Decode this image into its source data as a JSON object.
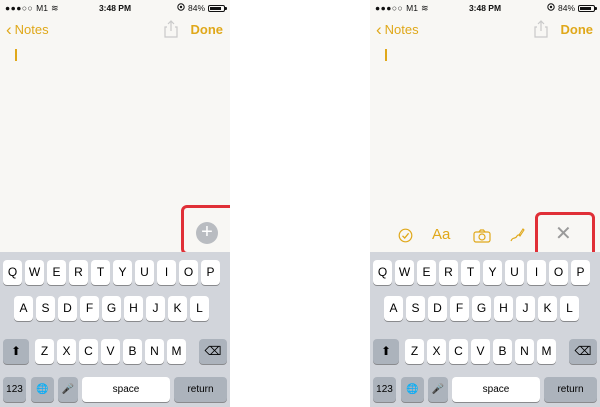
{
  "status_bar": {
    "signal": "●●●○○",
    "carrier": "M1",
    "wifi": "≋",
    "time": "3:48 PM",
    "battery_percent": "84%",
    "battery_level": 0.84
  },
  "nav": {
    "back_label": "Notes",
    "done_label": "Done"
  },
  "toolbar": {
    "add_symbol": "+",
    "close_symbol": "✕",
    "format_label": "Aa",
    "checklist_symbol": "✓"
  },
  "keyboard": {
    "row1": [
      "Q",
      "W",
      "E",
      "R",
      "T",
      "Y",
      "U",
      "I",
      "O",
      "P"
    ],
    "row2": [
      "A",
      "S",
      "D",
      "F",
      "G",
      "H",
      "J",
      "K",
      "L"
    ],
    "row3": [
      "Z",
      "X",
      "C",
      "V",
      "B",
      "N",
      "M"
    ],
    "numbers_label": "123",
    "space_label": "space",
    "return_label": "return",
    "shift_symbol": "⬆",
    "delete_symbol": "⌫",
    "globe_symbol": "🌐",
    "mic_symbol": "🎤"
  },
  "colors": {
    "accent": "#e0a81a",
    "highlight": "#e02f37",
    "keyboard_bg": "#d2d5db"
  },
  "icons": [
    "signal-icon",
    "wifi-icon",
    "location-icon",
    "battery-icon",
    "back-chevron-icon",
    "share-icon",
    "add-icon",
    "checklist-icon",
    "format-text-icon",
    "camera-icon",
    "sketch-icon",
    "close-icon",
    "shift-icon",
    "delete-icon",
    "globe-icon",
    "microphone-icon"
  ]
}
